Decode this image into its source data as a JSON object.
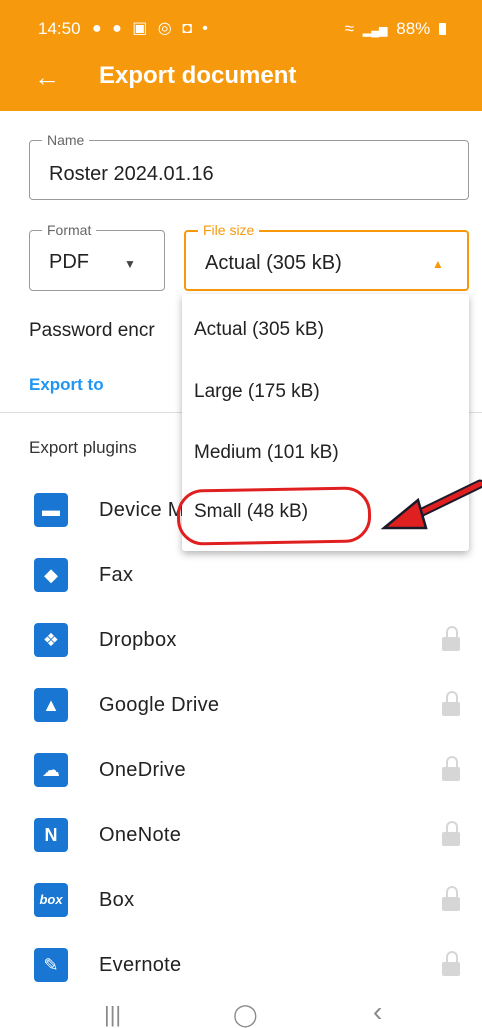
{
  "status_bar": {
    "time": "14:50",
    "notification_icons": "● ● ▣ ◎ ◘ •",
    "wifi": "≈",
    "signal": "▂▄▆",
    "battery": "88%"
  },
  "app_bar": {
    "back_icon": "←",
    "title": "Export document"
  },
  "form": {
    "name": {
      "label": "Name",
      "value": "Roster 2024.01.16"
    },
    "format": {
      "label": "Format",
      "value": "PDF",
      "caret": "▼"
    },
    "file_size": {
      "label": "File size",
      "value": "Actual (305 kB)",
      "caret": "▲"
    },
    "password_label": "Password encr"
  },
  "export_to": "Export to",
  "plugins_title": "Export plugins",
  "plugins": [
    {
      "label": "Device M",
      "icon": "folder-icon",
      "glyph": "▬",
      "locked": false
    },
    {
      "label": "Fax",
      "icon": "fax-icon",
      "glyph": "◆",
      "locked": false
    },
    {
      "label": "Dropbox",
      "icon": "dropbox-icon",
      "glyph": "❖",
      "locked": true
    },
    {
      "label": "Google Drive",
      "icon": "google-drive-icon",
      "glyph": "▲",
      "locked": true
    },
    {
      "label": "OneDrive",
      "icon": "onedrive-icon",
      "glyph": "☁",
      "locked": true
    },
    {
      "label": "OneNote",
      "icon": "onenote-icon",
      "glyph": "N",
      "locked": true
    },
    {
      "label": "Box",
      "icon": "box-icon",
      "glyph": "box",
      "locked": true
    },
    {
      "label": "Evernote",
      "icon": "evernote-icon",
      "glyph": "✎",
      "locked": true
    }
  ],
  "dropdown": {
    "options": [
      "Actual (305 kB)",
      "Large (175 kB)",
      "Medium (101 kB)",
      "Small (48 kB)"
    ]
  },
  "nav_bar": {
    "recents": "|||",
    "home": "◯",
    "back": "‹"
  },
  "colors": {
    "accent": "#f7990c",
    "link": "#2196f3",
    "plugin_icon": "#1976d2",
    "annotation": "#e02020"
  }
}
